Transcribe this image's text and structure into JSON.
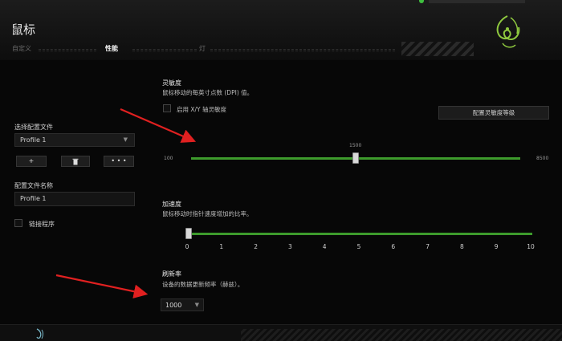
{
  "header": {
    "title": "鼠标",
    "ghost_tab_1": "",
    "ghost_tab_2": "",
    "tabs": [
      {
        "label": "自定义",
        "active": false
      },
      {
        "label": "性能",
        "active": true
      },
      {
        "label": "灯",
        "active": false
      }
    ],
    "logo_icon": "razer-snake-logo"
  },
  "left_panel": {
    "profile_select_label": "选择配置文件",
    "profile_selected": "Profile 1",
    "buttons": [
      {
        "label": "+",
        "icon": "add-icon"
      },
      {
        "label": "",
        "icon": "trash-icon"
      },
      {
        "label": "• • •",
        "icon": "more-icon"
      }
    ],
    "profile_name_label": "配置文件名称",
    "profile_name_value": "Profile 1",
    "link_program_label": "链接程序",
    "link_program_checked": false
  },
  "sensitivity": {
    "title": "灵敏度",
    "description": "鼠标移动的每英寸点数 (DPI) 值。",
    "xy_checkbox_label": "启用 X/Y 轴灵敏度",
    "xy_checked": false,
    "config_button": "配置灵敏度等级",
    "min_label": "100",
    "max_label": "8500",
    "value_label": "1500",
    "min": 100,
    "max": 8500,
    "value": 1500,
    "value_fraction": 0.5
  },
  "acceleration": {
    "title": "加速度",
    "description": "鼠标移动时指针速度增加的比率。",
    "ticks": [
      "0",
      "1",
      "2",
      "3",
      "4",
      "5",
      "6",
      "7",
      "8",
      "9",
      "10"
    ],
    "value": 0
  },
  "polling": {
    "title": "刷新率",
    "description": "设备的数据更新频率（赫兹）。",
    "value": "1000"
  },
  "colors": {
    "accent": "#3d9b2c",
    "background": "#070707",
    "annotation_arrow": "#e02020"
  }
}
